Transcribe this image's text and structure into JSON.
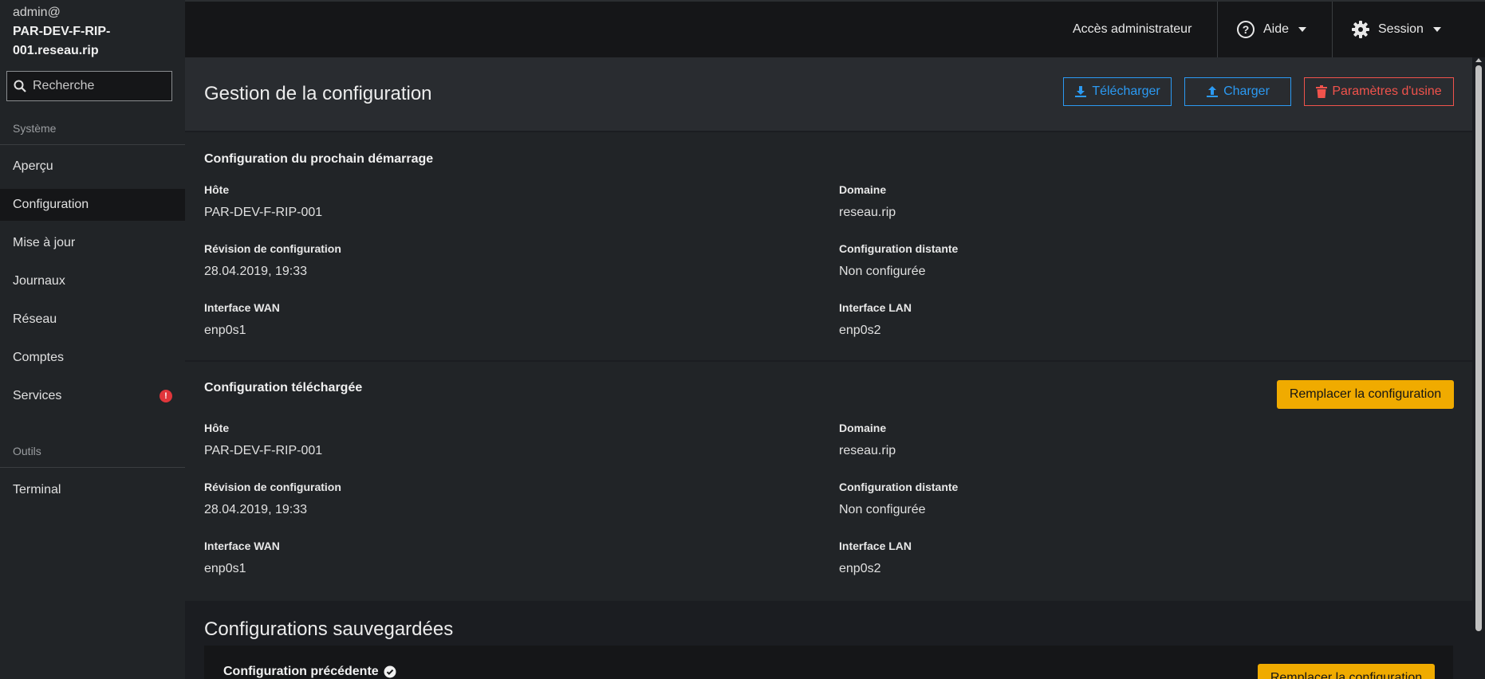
{
  "sidebar": {
    "user": "admin@",
    "hostname": "PAR-DEV-F-RIP-001.reseau.rip",
    "search_placeholder": "Recherche",
    "section_system": "Système",
    "section_tools": "Outils",
    "items": [
      {
        "label": "Aperçu"
      },
      {
        "label": "Configuration",
        "active": true
      },
      {
        "label": "Mise à jour"
      },
      {
        "label": "Journaux"
      },
      {
        "label": "Réseau"
      },
      {
        "label": "Comptes"
      },
      {
        "label": "Services",
        "badge": "!"
      }
    ],
    "tools": [
      {
        "label": "Terminal"
      }
    ]
  },
  "topbar": {
    "admin_access": "Accès administrateur",
    "help": "Aide",
    "session": "Session"
  },
  "page": {
    "title": "Gestion de la configuration",
    "download": "Télécharger",
    "upload": "Charger",
    "factory_reset": "Paramètres d'usine"
  },
  "next_boot": {
    "title": "Configuration du prochain démarrage",
    "host_label": "Hôte",
    "host_value": "PAR-DEV-F-RIP-001",
    "domain_label": "Domaine",
    "domain_value": "reseau.rip",
    "revision_label": "Révision de configuration",
    "revision_value": "28.04.2019, 19:33",
    "remote_label": "Configuration distante",
    "remote_value": "Non configurée",
    "wan_label": "Interface WAN",
    "wan_value": "enp0s1",
    "lan_label": "Interface LAN",
    "lan_value": "enp0s2"
  },
  "downloaded": {
    "title": "Configuration téléchargée",
    "replace": "Remplacer la configuration",
    "host_label": "Hôte",
    "host_value": "PAR-DEV-F-RIP-001",
    "domain_label": "Domaine",
    "domain_value": "reseau.rip",
    "revision_label": "Révision de configuration",
    "revision_value": "28.04.2019, 19:33",
    "remote_label": "Configuration distante",
    "remote_value": "Non configurée",
    "wan_label": "Interface WAN",
    "wan_value": "enp0s1",
    "lan_label": "Interface LAN",
    "lan_value": "enp0s2"
  },
  "saved": {
    "title": "Configurations sauvegardées",
    "previous": "Configuration précédente",
    "replace": "Remplacer la configuration"
  }
}
